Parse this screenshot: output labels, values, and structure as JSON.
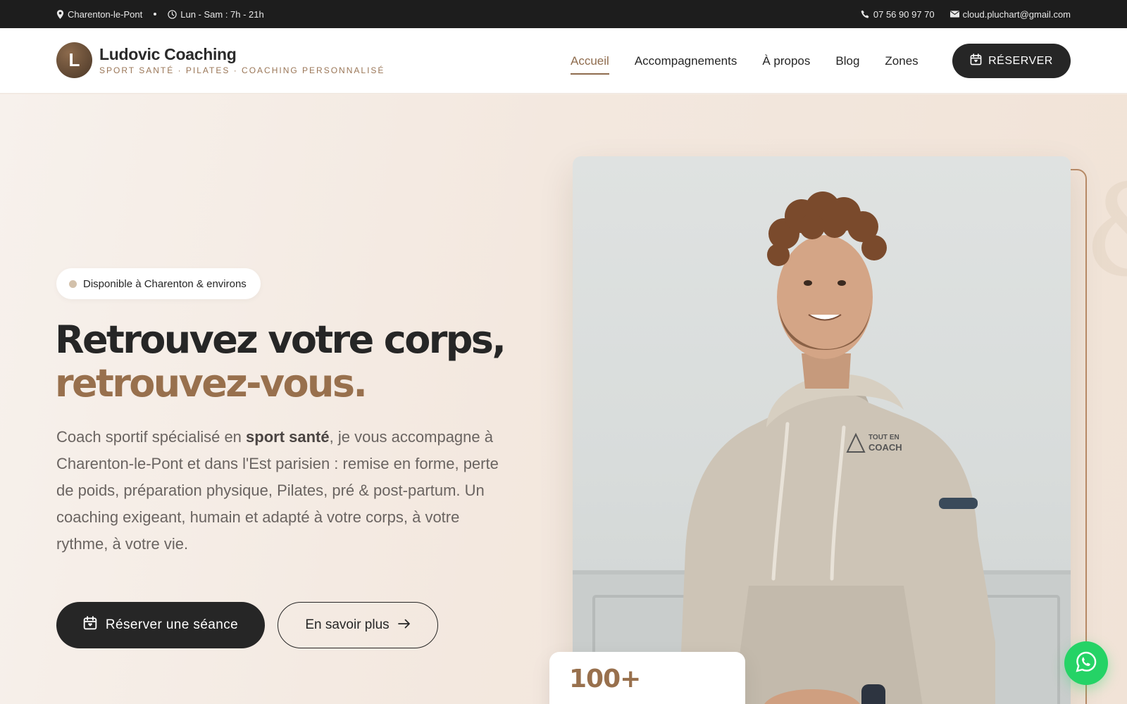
{
  "topbar": {
    "location": "Charenton-le-Pont",
    "hours": "Lun - Sam : 7h - 21h",
    "phone": "07 56 90 97 70",
    "email": "cloud.pluchart@gmail.com"
  },
  "brand": {
    "logo_letter": "L",
    "name": "Ludovic Coaching",
    "tagline": "SPORT SANTÉ · PILATES · COACHING PERSONNALISÉ"
  },
  "nav": {
    "items": [
      "Accueil",
      "Accompagnements",
      "À propos",
      "Blog",
      "Zones"
    ],
    "active": "Accueil",
    "reserve_label": "RÉSERVER"
  },
  "hero": {
    "badge": "Disponible à Charenton & environs",
    "headline_line1": "Retrouvez votre corps,",
    "headline_line2": "retrouvez-vous.",
    "lead_before": "Coach sportif spécialisé en ",
    "lead_bold": "sport santé",
    "lead_after": ", je vous accompagne à Charenton-le-Pont et dans l'Est parisien : remise en forme, perte de poids, préparation physique, Pilates, pré & post-partum. Un coaching exigeant, humain et adapté à votre corps, à votre rythme, à votre vie.",
    "cta_primary": "Réserver une séance",
    "cta_secondary": "En savoir plus",
    "stat_number": "100+",
    "hoodie_text_1": "TOUT EN",
    "hoodie_text_2": "COACH"
  },
  "colors": {
    "accent": "#98704d",
    "dark": "#262626",
    "topbar": "#1d1d1d",
    "whatsapp": "#25d366"
  },
  "icons": [
    "map-pin-icon",
    "clock-icon",
    "phone-icon",
    "mail-icon",
    "calendar-icon",
    "arrow-right-icon",
    "whatsapp-icon"
  ]
}
